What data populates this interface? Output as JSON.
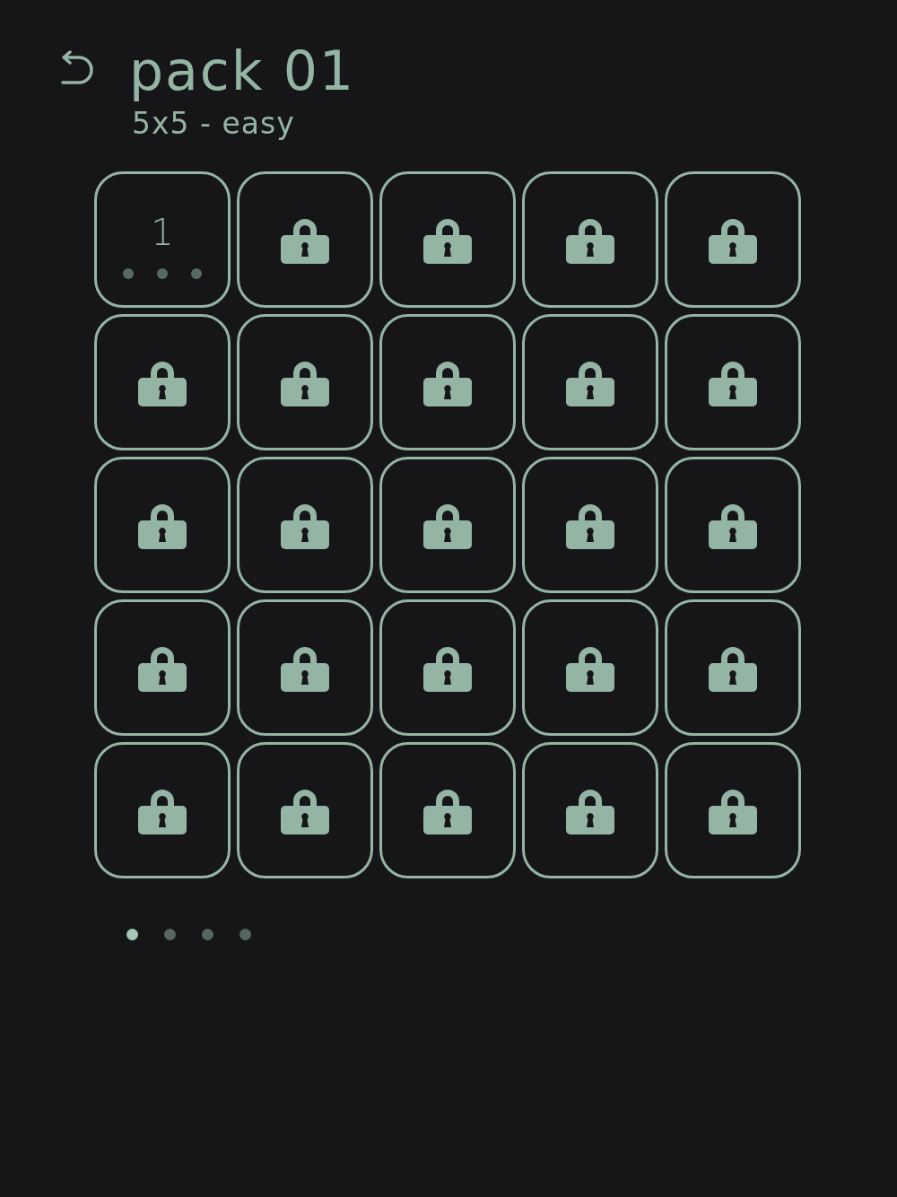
{
  "header": {
    "title": "pack 01",
    "subtitle": "5x5 - easy"
  },
  "levels": [
    {
      "kind": "open",
      "label": "1",
      "stars": 0
    },
    {
      "kind": "locked"
    },
    {
      "kind": "locked"
    },
    {
      "kind": "locked"
    },
    {
      "kind": "locked"
    },
    {
      "kind": "locked"
    },
    {
      "kind": "locked"
    },
    {
      "kind": "locked"
    },
    {
      "kind": "locked"
    },
    {
      "kind": "locked"
    },
    {
      "kind": "locked"
    },
    {
      "kind": "locked"
    },
    {
      "kind": "locked"
    },
    {
      "kind": "locked"
    },
    {
      "kind": "locked"
    },
    {
      "kind": "locked"
    },
    {
      "kind": "locked"
    },
    {
      "kind": "locked"
    },
    {
      "kind": "locked"
    },
    {
      "kind": "locked"
    },
    {
      "kind": "locked"
    },
    {
      "kind": "locked"
    },
    {
      "kind": "locked"
    },
    {
      "kind": "locked"
    },
    {
      "kind": "locked"
    }
  ],
  "pages": [
    {
      "selected": true
    },
    {
      "selected": false
    },
    {
      "selected": false
    },
    {
      "selected": false
    }
  ]
}
